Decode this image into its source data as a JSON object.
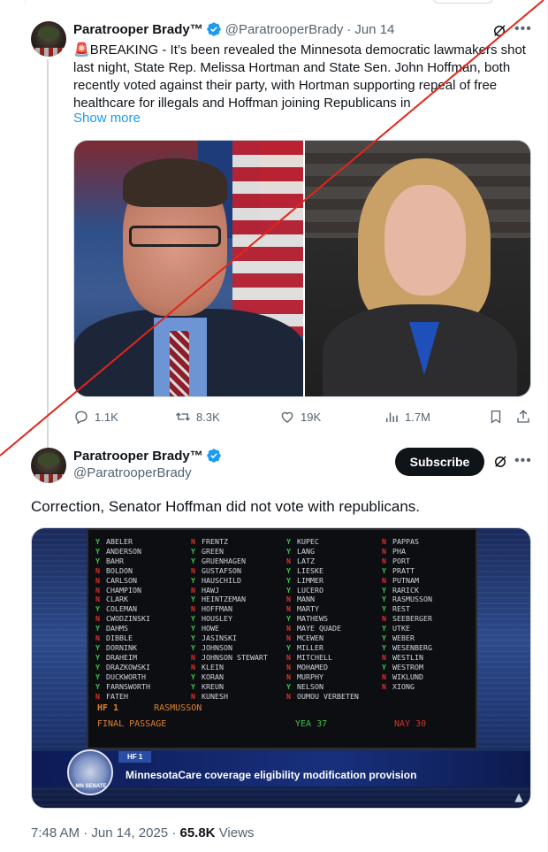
{
  "thread": {
    "author_name": "Paratrooper Brady™",
    "author_handle": "@ParatrooperBrady",
    "separator": "·",
    "date": "Jun 14",
    "text_emoji": "🚨",
    "text": "BREAKING - It’s been revealed the Minnesota democratic lawmakers shot last night, State Rep. Melissa Hortman and State Sen. John Hoffman, both recently voted against their party, with Hortman supporting repeal of free healthcare for illegals and Hoffman joining Republicans in",
    "show_more": "Show more",
    "stats": {
      "replies": "1.1K",
      "reposts": "8.3K",
      "likes": "19K",
      "views": "1.7M"
    }
  },
  "main": {
    "author_name": "Paratrooper Brady™",
    "author_handle": "@ParatrooperBrady",
    "subscribe_label": "Subscribe",
    "text": "Correction, Senator Hoffman did not vote with republicans.",
    "footer": {
      "time": "7:48 AM",
      "separator": "·",
      "date": "Jun 14, 2025",
      "separator2": "·",
      "views_count": "65.8K",
      "views_label": "Views"
    }
  },
  "vote_board": {
    "columns": [
      [
        [
          "Y",
          "ABELER"
        ],
        [
          "Y",
          "ANDERSON"
        ],
        [
          "Y",
          "BAHR"
        ],
        [
          "N",
          "BOLDON"
        ],
        [
          "N",
          "CARLSON"
        ],
        [
          "N",
          "CHAMPION"
        ],
        [
          "N",
          "CLARK"
        ],
        [
          "Y",
          "COLEMAN"
        ],
        [
          "N",
          "CWODZINSKI"
        ],
        [
          "Y",
          "DAHMS"
        ],
        [
          "N",
          "DIBBLE"
        ],
        [
          "Y",
          "DORNINK"
        ],
        [
          "Y",
          "DRAHEIM"
        ],
        [
          "Y",
          "DRAZKOWSKI"
        ],
        [
          "Y",
          "DUCKWORTH"
        ],
        [
          "Y",
          "FARNSWORTH"
        ],
        [
          "N",
          "FATEH"
        ]
      ],
      [
        [
          "N",
          "FRENTZ"
        ],
        [
          "Y",
          "GREEN"
        ],
        [
          "Y",
          "GRUENHAGEN"
        ],
        [
          "N",
          "GUSTAFSON"
        ],
        [
          "Y",
          "HAUSCHILD"
        ],
        [
          "N",
          "HAWJ"
        ],
        [
          "Y",
          "HEINTZEMAN"
        ],
        [
          "N",
          "HOFFMAN"
        ],
        [
          "Y",
          "HOUSLEY"
        ],
        [
          "Y",
          "HOWE"
        ],
        [
          "Y",
          "JASINSKI"
        ],
        [
          "Y",
          "JOHNSON"
        ],
        [
          "N",
          "JOHNSON STEWART"
        ],
        [
          "N",
          "KLEIN"
        ],
        [
          "Y",
          "KORAN"
        ],
        [
          "Y",
          "KREUN"
        ],
        [
          "N",
          "KUNESH"
        ]
      ],
      [
        [
          "Y",
          "KUPEC"
        ],
        [
          "Y",
          "LANG"
        ],
        [
          "N",
          "LATZ"
        ],
        [
          "Y",
          "LIESKE"
        ],
        [
          "Y",
          "LIMMER"
        ],
        [
          "Y",
          "LUCERO"
        ],
        [
          "N",
          "MANN"
        ],
        [
          "N",
          "MARTY"
        ],
        [
          "Y",
          "MATHEWS"
        ],
        [
          "N",
          "MAYE QUADE"
        ],
        [
          "N",
          "MCEWEN"
        ],
        [
          "Y",
          "MILLER"
        ],
        [
          "N",
          "MITCHELL"
        ],
        [
          "N",
          "MOHAMED"
        ],
        [
          "N",
          "MURPHY"
        ],
        [
          "Y",
          "NELSON"
        ],
        [
          "N",
          "OUMOU VERBETEN"
        ]
      ],
      [
        [
          "N",
          "PAPPAS"
        ],
        [
          "N",
          "PHA"
        ],
        [
          "N",
          "PORT"
        ],
        [
          "Y",
          "PRATT"
        ],
        [
          "N",
          "PUTNAM"
        ],
        [
          "Y",
          "RARICK"
        ],
        [
          "Y",
          "RASMUSSON"
        ],
        [
          "Y",
          "REST"
        ],
        [
          "N",
          "SEEBERGER"
        ],
        [
          "Y",
          "UTKE"
        ],
        [
          "Y",
          "WEBER"
        ],
        [
          "Y",
          "WESENBERG"
        ],
        [
          "N",
          "WESTLIN"
        ],
        [
          "Y",
          "WESTROM"
        ],
        [
          "N",
          "WIKLUND"
        ],
        [
          "N",
          "XIONG"
        ]
      ]
    ],
    "hf": "HF 1",
    "author": "RASMUSSON",
    "stage": "FINAL PASSAGE",
    "yea": "YEA 37",
    "nay": "NAY 30",
    "lower_tag": "HF 1",
    "lower_title": "MinnesotaCare coverage eligibility modification provision",
    "seal_text": "MN SENATE"
  },
  "colors": {
    "link": "#1d9bf0",
    "verified": "#1d9bf0",
    "yea": "#3ec14a",
    "nay": "#d8312c",
    "strike_line": "#e0261c"
  },
  "icons": [
    "more-icon",
    "grok-icon",
    "reply-icon",
    "repost-icon",
    "like-icon",
    "views-icon",
    "bookmark-icon",
    "share-icon",
    "verified-icon"
  ]
}
